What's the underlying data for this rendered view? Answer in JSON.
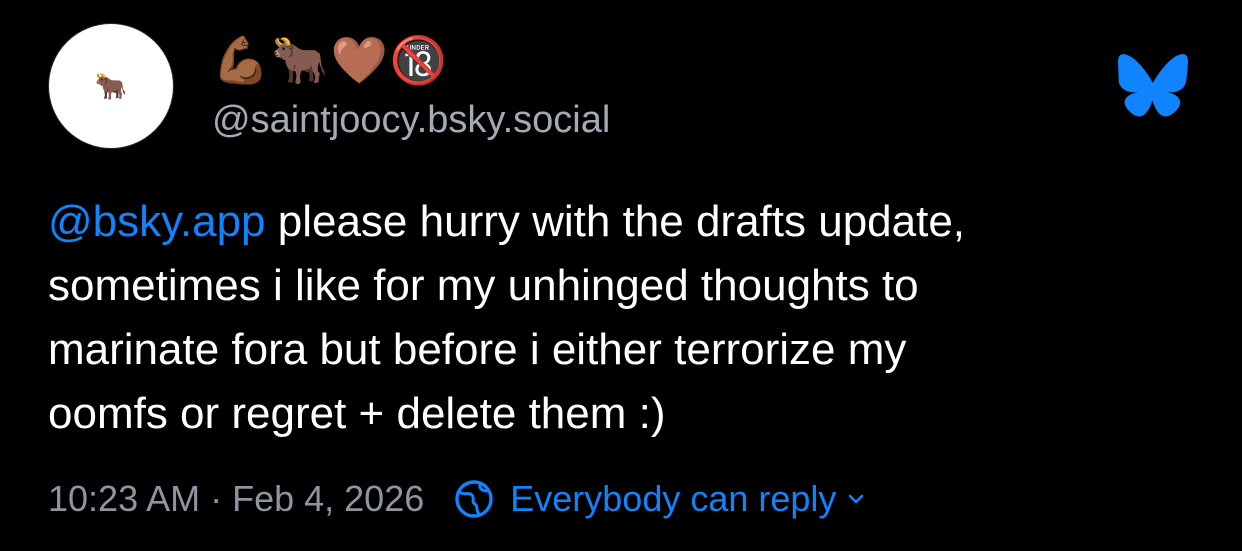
{
  "post": {
    "author": {
      "avatar_emoji": "🐂",
      "display_name": "💪🏾🐂🤎🔞",
      "handle": "@saintjoocy.bsky.social"
    },
    "text": {
      "mention": "@bsky.app",
      "line1_rest": " please hurry with the drafts update,",
      "line2": "sometimes i like for my unhinged thoughts to",
      "line3": "marinate fora but before i either terrorize my",
      "line4": "oomfs or regret + delete them :)"
    },
    "timestamp": "10:23 AM · Feb 4, 2026",
    "reply_setting": "Everybody can reply"
  },
  "icons": {
    "brand": "bluesky-butterfly-icon",
    "reply": "globe-icon",
    "dropdown": "chevron-down-icon"
  },
  "colors": {
    "background": "#000000",
    "text": "#ffffff",
    "handle": "#a3aab4",
    "timestamp": "#8d95a0",
    "accent": "#1083fe"
  }
}
